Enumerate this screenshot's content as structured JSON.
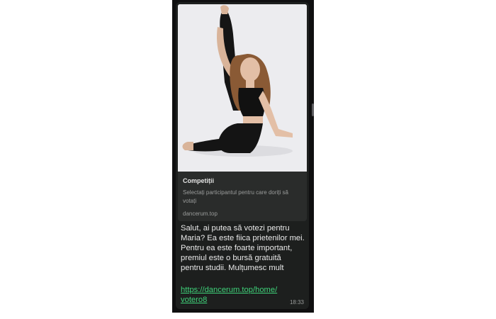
{
  "preview": {
    "title": "Competiții",
    "description": "Selectați participantul pentru care doriți să votați",
    "domain": "dancerum.top",
    "image_subject": "girl-in-black-dance-outfit-stretching"
  },
  "message": {
    "text": "Salut, ai putea să votezi pentru\nMaria? Ea este fiica prietenilor mei.\nPentru ea este foarte important,\npremiul este o bursă gratuită\npentru studii.  Mulțumesc mult",
    "link": "https://dancerum.top/home/\nvotero8",
    "time": "18:33"
  },
  "colors": {
    "bubble": "#1d1f1e",
    "card": "#2a2c2b",
    "link": "#3fd37a",
    "text": "#eaeaea",
    "muted": "#9a9c9b"
  }
}
